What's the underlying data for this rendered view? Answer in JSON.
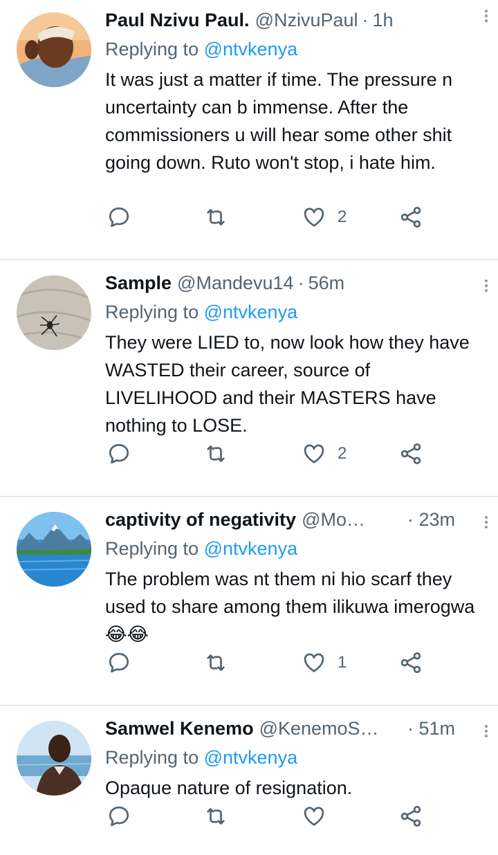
{
  "colors": {
    "text": "#0f1419",
    "secondary": "#536471",
    "link": "#1d9bf0",
    "divider": "#cfd9de"
  },
  "reply_prefix": "Replying to",
  "tweets": [
    {
      "name": "Paul Nzivu Paul.",
      "handle": "@NzivuPaul",
      "time": "1h",
      "reply_to": "@ntvkenya",
      "text": "It was just a matter if time. The pressure n uncertainty can b immense. After the commissioners u will hear some other shit going down. Ruto won't stop, i hate him.",
      "likes": "2",
      "avatar_icon": "person-photo"
    },
    {
      "name": "Sample",
      "handle": "@Mandevu14",
      "time": "56m",
      "reply_to": "@ntvkenya",
      "text": "They were LIED to, now look how they have WASTED their career, source of LIVELIHOOD and their MASTERS have nothing to LOSE.",
      "likes": "2",
      "avatar_icon": "spider-on-sand"
    },
    {
      "name": "captivity of negativity",
      "handle": "@Mo…",
      "time": "23m",
      "reply_to": "@ntvkenya",
      "text": "The problem was nt them ni hio scarf they used to share among them ilikuwa imerogwa😂😂",
      "likes": "1",
      "avatar_icon": "mountain-lake"
    },
    {
      "name": "Samwel Kenemo",
      "handle": "@KenemoS…",
      "time": "51m",
      "reply_to": "@ntvkenya",
      "text": "Opaque nature of resignation.",
      "likes": "",
      "avatar_icon": "person-by-water"
    }
  ]
}
